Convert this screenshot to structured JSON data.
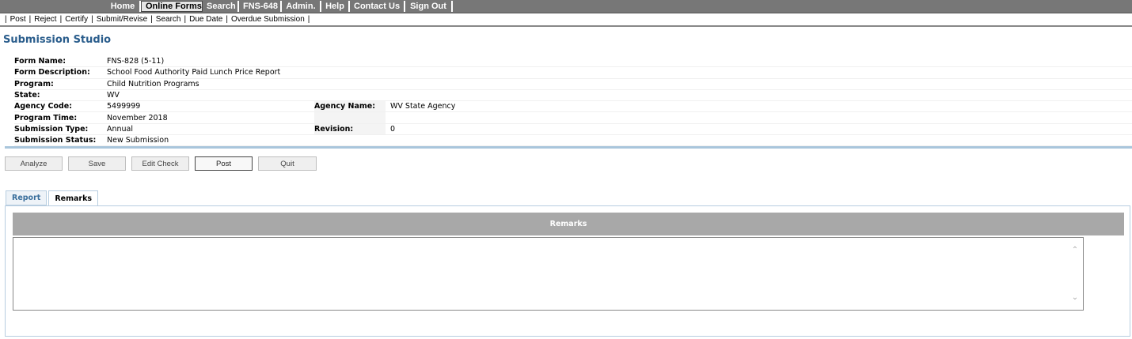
{
  "nav": {
    "items": [
      "Home",
      "Online Forms",
      "Search",
      "FNS-648",
      "Admin.",
      "Help",
      "Contact Us",
      "Sign Out"
    ],
    "active": "Online Forms"
  },
  "subnav": {
    "items": [
      "Post",
      "Reject",
      "Certify",
      "Submit/Revise",
      "Search",
      "Due Date",
      "Overdue Submission"
    ]
  },
  "page": {
    "title": "Submission Studio"
  },
  "info": {
    "form_name_label": "Form Name:",
    "form_name": "FNS-828 (5-11)",
    "form_desc_label": "Form Description:",
    "form_desc": "School Food Authority Paid Lunch Price Report",
    "program_label": "Program:",
    "program": "Child Nutrition Programs",
    "state_label": "State:",
    "state": "WV",
    "agency_code_label": "Agency Code:",
    "agency_code": "5499999",
    "agency_name_label": "Agency Name:",
    "agency_name": "WV State Agency",
    "program_time_label": "Program Time:",
    "program_time": "November 2018",
    "submission_type_label": "Submission Type:",
    "submission_type": "Annual",
    "revision_label": "Revision:",
    "revision": "0",
    "submission_status_label": "Submission Status:",
    "submission_status": "New Submission"
  },
  "buttons": {
    "analyze": "Analyze",
    "save": "Save",
    "edit_check": "Edit Check",
    "post": "Post",
    "quit": "Quit"
  },
  "tabs": {
    "report": "Report",
    "remarks": "Remarks"
  },
  "remarks_panel": {
    "header": "Remarks",
    "value": ""
  },
  "colors": {
    "title": "#2a5d8c",
    "nav_bg": "#777777",
    "panel_header": "#a8a8a8",
    "divider": "#a9c6dc"
  }
}
